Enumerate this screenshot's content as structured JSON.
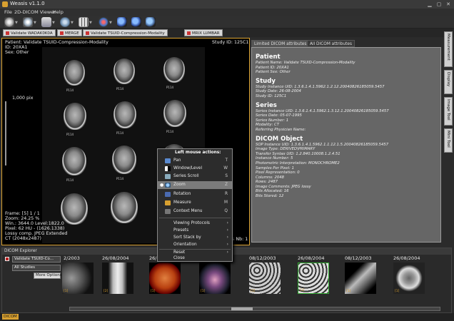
{
  "window": {
    "title": "Weasis v1.1.0"
  },
  "menu": [
    "File",
    "2D-DICOM Viewer",
    "Help"
  ],
  "toolbar": {
    "buttons": [
      "open-file-icon",
      "open-cdrom-icon",
      "import-icon",
      "export-icon",
      "layout-icon",
      "sync-icon",
      "zoom-in-icon",
      "zoom-out-icon",
      "best-fit-icon"
    ]
  },
  "study_tabs": [
    "Validate WADAK0K0A",
    "MERGE",
    "Validate TSUID-Compression-Modality",
    "MRIX LUMBAR"
  ],
  "viewer": {
    "top_left": [
      "Patient: Validate TSUID-Compression-Modality",
      "ID: 20XA1",
      "Sex: Other"
    ],
    "top_right": "Study ID: 125C1",
    "scale": "1,000 pix",
    "bottom_left": [
      "Frame: [5] 1 / 1",
      "Zoom: 24.25 %",
      "Win.: 3644.0 Level:1822.0",
      "Pixel: 62 HU - (1626.1338)"
    ],
    "lossy": "Lossy comp. JPEG Extended",
    "bottom_left_last": "CT (2048x2487)",
    "bottom_right": "Series Nb: 1",
    "film_labels": [
      "P114",
      "P114",
      "P114",
      "P114",
      "P114",
      "P114",
      "P114",
      "P114",
      "P114"
    ]
  },
  "attr_tabs": [
    "Limited DICOM attributes",
    "All DICOM attributes"
  ],
  "attributes": {
    "patient": {
      "title": "Patient",
      "lines": [
        "Patient Name: Validate TSUID-Compression-Modality",
        "Patient ID: 20XA1",
        "Patient Sex: Other"
      ]
    },
    "study": {
      "title": "Study",
      "lines": [
        "Study Instance UID: 1.3.6.1.4.1.5962.1.2.12.20040826185059.5457",
        "Study Date: 26-08-2004",
        "Study ID: 125C1"
      ]
    },
    "series": {
      "title": "Series",
      "lines": [
        "Series Instance UID: 1.3.6.1.4.1.5962.1.3.12.1.20040826185059.5457",
        "Series Date: 05-07-1995",
        "Series Number: 1",
        "Modality: CT",
        "Referring Physician Name:"
      ]
    },
    "dicom": {
      "title": "DICOM Object",
      "lines": [
        "SOP Instance UID: 1.3.6.1.4.1.5962.1.1.12.1.5.20040826185059.5457",
        "Image Type: DERIVED\\PRIMARY",
        "Transfer Syntax UID: 1.2.840.10008.1.2.4.51",
        "Instance Number: 5",
        "Photometric Interpretation: MONOCHROME2",
        "Samples Per Pixel: 1",
        "Pixel Representation: 0",
        "Columns: 2048",
        "Rows: 2487",
        "Image Comments: JPEG lossy",
        "Bits Allocated: 16",
        "Bits Stored: 12"
      ]
    }
  },
  "side_tabs": [
    "Measurement",
    "Display",
    "Image Tool",
    "Mini Tool"
  ],
  "context_menu": {
    "header": "Left mouse actions:",
    "actions": [
      {
        "label": "Pan",
        "key": "T"
      },
      {
        "label": "Window/Level",
        "key": "W"
      },
      {
        "label": "Series Scroll",
        "key": "S"
      },
      {
        "label": "Zoom",
        "key": "Z"
      },
      {
        "label": "Rotation",
        "key": "R"
      },
      {
        "label": "Measure",
        "key": "M"
      },
      {
        "label": "Context Menu",
        "key": "Q"
      }
    ],
    "submenus": [
      "Viewing Protocols",
      "Presets",
      "Sort Stack by",
      "Orientation",
      "Reset"
    ],
    "close": "Close"
  },
  "explorer": {
    "title": "DICOM Explorer",
    "patient_select": "Validate TSUID-Co...",
    "study_select": "All Studies",
    "more_options": "More Options",
    "dates": [
      "2/2003",
      "26/08/2004",
      "26/08/2004",
      "08/12/2003",
      "26/08/2004",
      "08/12/2003",
      "26/08/2004"
    ],
    "thumb_labels": [
      "[1]",
      "[2]",
      "[1]",
      "[1]",
      "[1]",
      "[1]",
      "[1]",
      "[1]"
    ]
  },
  "status": "DICOM"
}
